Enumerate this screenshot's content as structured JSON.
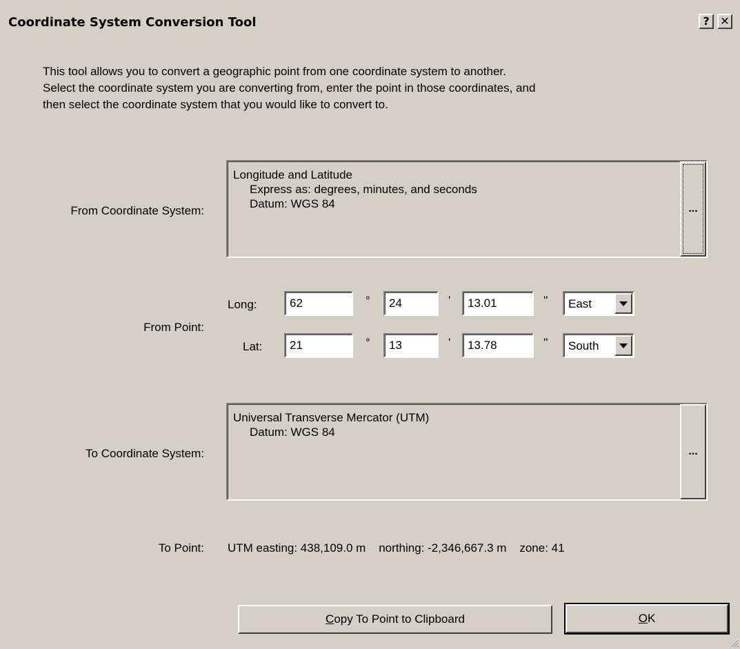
{
  "window": {
    "title": "Coordinate System Conversion Tool",
    "help_label": "?",
    "close_label": "✕"
  },
  "description": [
    "This tool allows you to convert a geographic point from one coordinate system to another.",
    "Select the coordinate system you are converting from, enter the point in those coordinates, and",
    "then select the coordinate system that you would like to convert to."
  ],
  "from_system": {
    "label": "From Coordinate System:",
    "lines": [
      "Longitude and Latitude",
      "Express as: degrees, minutes, and seconds",
      "Datum: WGS 84"
    ],
    "button_label": "..."
  },
  "from_point": {
    "label": "From Point:",
    "long": {
      "label": "Long:",
      "degrees": "62",
      "minutes": "24",
      "seconds": "13.01",
      "direction": "East"
    },
    "lat": {
      "label": "Lat:",
      "degrees": "21",
      "minutes": "13",
      "seconds": "13.78",
      "direction": "South"
    },
    "degree_mark": "°",
    "minute_mark": "'",
    "second_mark": "''"
  },
  "to_system": {
    "label": "To Coordinate System:",
    "lines": [
      "Universal Transverse Mercator (UTM)",
      "Datum: WGS 84"
    ],
    "button_label": "..."
  },
  "to_point": {
    "label": "To Point:",
    "value": "UTM easting: 438,109.0 m    northing: -2,346,667.3 m    zone: 41"
  },
  "buttons": {
    "copy_label_mnemonic": "C",
    "copy_label_rest": "opy To Point to Clipboard",
    "ok_label_mnemonic": "O",
    "ok_label_rest": "K"
  }
}
